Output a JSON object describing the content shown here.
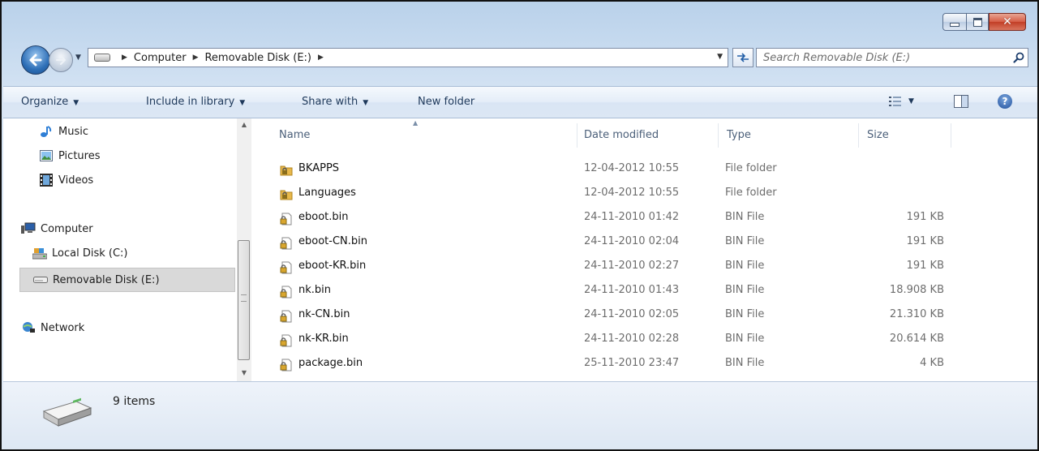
{
  "window": {
    "minimize_label": "",
    "maximize_label": "",
    "close_glyph": "✕"
  },
  "nav": {
    "back_icon": "back-arrow-icon",
    "forward_icon": "forward-arrow-icon",
    "breadcrumb": [
      {
        "label": "Computer"
      },
      {
        "label": "Removable Disk (E:)"
      }
    ],
    "search_placeholder": "Search Removable Disk (E:)"
  },
  "toolbar": {
    "organize": "Organize",
    "include_in_library": "Include in library",
    "share_with": "Share with",
    "new_folder": "New folder",
    "help": "?"
  },
  "sidebar": {
    "items": [
      {
        "label": "Music",
        "icon": "music-icon"
      },
      {
        "label": "Pictures",
        "icon": "pictures-icon"
      },
      {
        "label": "Videos",
        "icon": "videos-icon"
      },
      {
        "label": "Computer",
        "icon": "computer-icon"
      },
      {
        "label": "Local Disk (C:)",
        "icon": "local-disk-icon"
      },
      {
        "label": "Removable Disk (E:)",
        "icon": "removable-disk-icon",
        "selected": true
      },
      {
        "label": "Network",
        "icon": "network-icon"
      }
    ]
  },
  "files": {
    "columns": {
      "name": "Name",
      "date": "Date modified",
      "type": "Type",
      "size": "Size"
    },
    "rows": [
      {
        "name": "BKAPPS",
        "date": "12-04-2012 10:55",
        "type": "File folder",
        "size": "",
        "icon": "locked-folder-icon"
      },
      {
        "name": "Languages",
        "date": "12-04-2012 10:55",
        "type": "File folder",
        "size": "",
        "icon": "locked-folder-icon"
      },
      {
        "name": "eboot.bin",
        "date": "24-11-2010 01:42",
        "type": "BIN File",
        "size": "191 KB",
        "icon": "locked-file-icon"
      },
      {
        "name": "eboot-CN.bin",
        "date": "24-11-2010 02:04",
        "type": "BIN File",
        "size": "191 KB",
        "icon": "locked-file-icon"
      },
      {
        "name": "eboot-KR.bin",
        "date": "24-11-2010 02:27",
        "type": "BIN File",
        "size": "191 KB",
        "icon": "locked-file-icon"
      },
      {
        "name": "nk.bin",
        "date": "24-11-2010 01:43",
        "type": "BIN File",
        "size": "18.908 KB",
        "icon": "locked-file-icon"
      },
      {
        "name": "nk-CN.bin",
        "date": "24-11-2010 02:05",
        "type": "BIN File",
        "size": "21.310 KB",
        "icon": "locked-file-icon"
      },
      {
        "name": "nk-KR.bin",
        "date": "24-11-2010 02:28",
        "type": "BIN File",
        "size": "20.614 KB",
        "icon": "locked-file-icon"
      },
      {
        "name": "package.bin",
        "date": "25-11-2010 23:47",
        "type": "BIN File",
        "size": "4 KB",
        "icon": "locked-file-icon"
      }
    ]
  },
  "status": {
    "item_count": "9 items"
  },
  "colors": {
    "accent": "#2e6fb7",
    "close": "#c23e26",
    "selection": "#d9d9d9"
  }
}
